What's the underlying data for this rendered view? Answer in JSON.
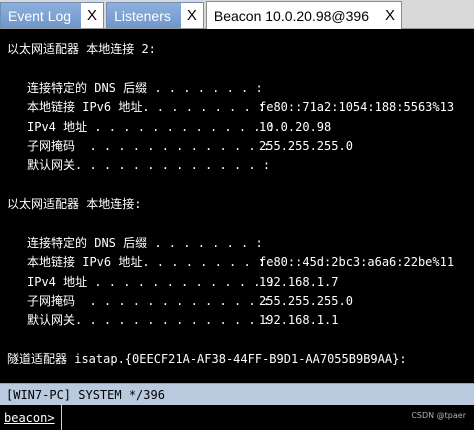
{
  "tabs": [
    {
      "label": "Event Log",
      "close": "X",
      "active": false
    },
    {
      "label": "Listeners",
      "close": "X",
      "active": false
    },
    {
      "label": "Beacon 10.0.20.98@396",
      "close": "X",
      "active": true
    }
  ],
  "console": {
    "adapter1": {
      "header": "以太网适配器 本地连接 2:",
      "rows": [
        {
          "key": "连接特定的 DNS 后缀 . . . . . . . :",
          "value": ""
        },
        {
          "key": "本地链接 IPv6 地址. . . . . . . . :",
          "value": "fe80::71a2:1054:188:5563%13"
        },
        {
          "key": "IPv4 地址 . . . . . . . . . . . . :",
          "value": "10.0.20.98"
        },
        {
          "key": "子网掩码  . . . . . . . . . . . . :",
          "value": "255.255.255.0"
        },
        {
          "key": "默认网关. . . . . . . . . . . . . :",
          "value": ""
        }
      ]
    },
    "adapter2": {
      "header": "以太网适配器 本地连接:",
      "rows": [
        {
          "key": "连接特定的 DNS 后缀 . . . . . . . :",
          "value": ""
        },
        {
          "key": "本地链接 IPv6 地址. . . . . . . . :",
          "value": "fe80::45d:2bc3:a6a6:22be%11"
        },
        {
          "key": "IPv4 地址 . . . . . . . . . . . . :",
          "value": "192.168.1.7"
        },
        {
          "key": "子网掩码  . . . . . . . . . . . . :",
          "value": "255.255.255.0"
        },
        {
          "key": "默认网关. . . . . . . . . . . . . :",
          "value": "192.168.1.1"
        }
      ]
    },
    "tunnel_line": "隧道适配器 isatap.{0EECF21A-AF38-44FF-B9D1-AA7055B9B9AA}:"
  },
  "statusbar": {
    "text": "[WIN7-PC] SYSTEM */396"
  },
  "commandline": {
    "prompt": "beacon>",
    "value": ""
  },
  "watermark": "CSDN @tpaer",
  "colors": {
    "console_bg": "#000000",
    "console_fg": "#ffffff",
    "statusbar_bg": "#b9c9de",
    "tab_inactive_bg": "#7ea2d4"
  }
}
